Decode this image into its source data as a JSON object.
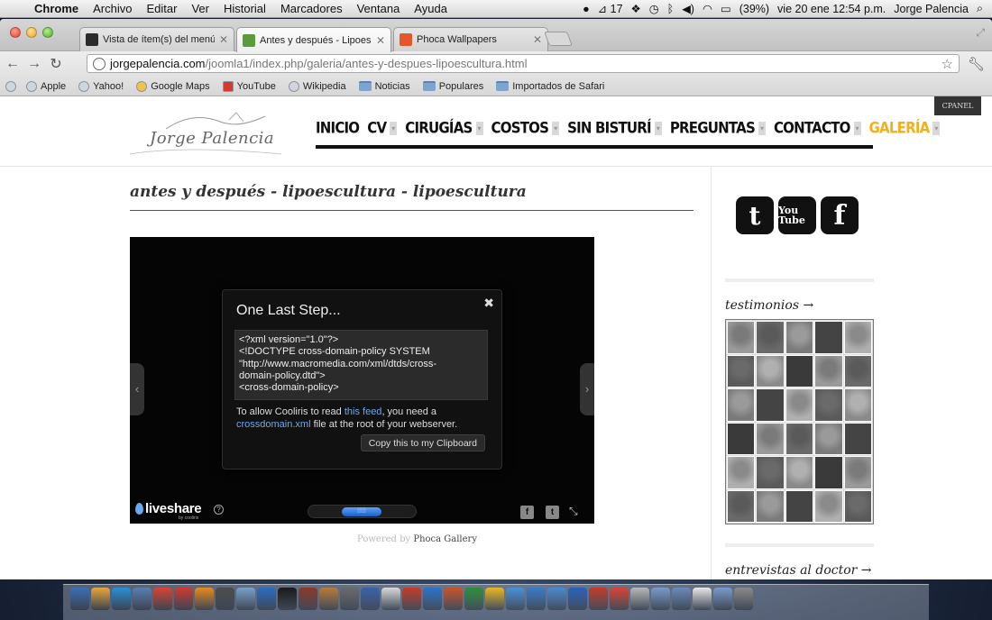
{
  "menubar": {
    "app": "Chrome",
    "menus": [
      "Archivo",
      "Editar",
      "Ver",
      "Historial",
      "Marcadores",
      "Ventana",
      "Ayuda"
    ],
    "adobe_count": "17",
    "battery": "(39%)",
    "datetime": "vie 20 ene  12:54 p.m.",
    "user": "Jorge Palencia"
  },
  "tabs": [
    {
      "label": "Vista de ítem(s) del menú",
      "color": "#2b2b2b",
      "active": false
    },
    {
      "label": "Antes y después - Lipoescult",
      "color": "#5a9c3c",
      "active": true
    },
    {
      "label": "Phoca Wallpapers",
      "color": "#e5572b",
      "active": false
    }
  ],
  "omnibox": {
    "host": "jorgepalencia.com",
    "path": "/joomla1/index.php/galeria/antes-y-despues-lipoescultura.html"
  },
  "bookmarks": [
    {
      "label": "Apple",
      "type": "site"
    },
    {
      "label": "Yahoo!",
      "type": "site"
    },
    {
      "label": "Google Maps",
      "type": "site"
    },
    {
      "label": "YouTube",
      "type": "site"
    },
    {
      "label": "Wikipedia",
      "type": "site"
    },
    {
      "label": "Noticias",
      "type": "folder"
    },
    {
      "label": "Populares",
      "type": "folder"
    },
    {
      "label": "Importados de Safari",
      "type": "folder"
    }
  ],
  "site": {
    "logo_text": "Jorge Palencia",
    "cpanel": "CPANEL",
    "nav": [
      {
        "label": "INICIO",
        "caret": false,
        "active": false
      },
      {
        "label": "CV",
        "caret": true,
        "active": false
      },
      {
        "label": "CIRUGÍAS",
        "caret": true,
        "active": false
      },
      {
        "label": "COSTOS",
        "caret": true,
        "active": false
      },
      {
        "label": "SIN BISTURÍ",
        "caret": true,
        "active": false
      },
      {
        "label": "PREGUNTAS",
        "caret": true,
        "active": false
      },
      {
        "label": "CONTACTO",
        "caret": true,
        "active": false
      },
      {
        "label": "GALERÍA",
        "caret": true,
        "active": true
      }
    ],
    "accent_color": "#f2b01e"
  },
  "content": {
    "title": "antes y después - lipoescultura - lipoescultura",
    "dialog": {
      "title": "One Last Step...",
      "xml_lines": [
        "<?xml version=\"1.0\"?>",
        "<!DOCTYPE cross-domain-policy SYSTEM",
        "\"http://www.macromedia.com/xml/dtds/cross-",
        "domain-policy.dtd\">",
        "<cross-domain-policy>"
      ],
      "msg_part1": "To allow Cooliris to read ",
      "msg_link1": "this feed",
      "msg_part2": ", you need a ",
      "msg_link2": "crossdomain.xml",
      "msg_part3": " file at the root of your webserver.",
      "copy_button": "Copy this to my Clipboard"
    },
    "player": {
      "brand": "liveshare",
      "brand_sub": "by cooliris"
    },
    "powered_prefix": "Powered by ",
    "powered_name": "Phoca Gallery"
  },
  "sidebar": {
    "social": [
      {
        "name": "twitter",
        "label": "t"
      },
      {
        "name": "youtube",
        "label": "You Tube"
      },
      {
        "name": "facebook",
        "label": "f"
      }
    ],
    "testimonios": "testimonios →",
    "entrevistas": "entrevistas al doctor →",
    "photo_count": 30
  }
}
